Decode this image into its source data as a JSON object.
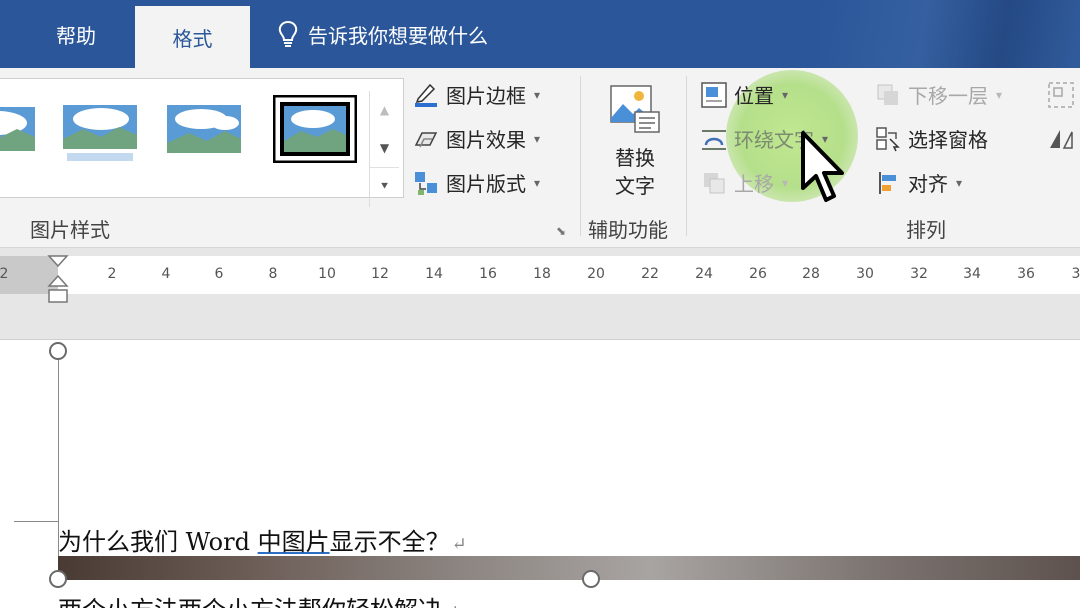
{
  "tabs": {
    "partial_label": "",
    "help": "帮助",
    "format": "格式",
    "tell_me": "告诉我你想要做什么"
  },
  "ribbon": {
    "picture_styles": {
      "label": "图片样式",
      "border": "图片边框",
      "effects": "图片效果",
      "layout": "图片版式"
    },
    "accessibility": {
      "label": "辅助功能",
      "alt_text_line1": "替换",
      "alt_text_line2": "文字"
    },
    "arrange": {
      "label": "排列",
      "position": "位置",
      "wrap_text": "环绕文字",
      "bring_forward": "上移",
      "send_backward": "下移一层",
      "selection_pane": "选择窗格",
      "align": "对齐"
    }
  },
  "ruler": {
    "left_label": "2",
    "ticks": [
      "2",
      "4",
      "6",
      "8",
      "10",
      "12",
      "14",
      "16",
      "18",
      "20",
      "22",
      "24",
      "26",
      "28",
      "30",
      "32",
      "34",
      "36",
      "3"
    ]
  },
  "document": {
    "line1_pre": "为什么我们 Word ",
    "line1_underlined": "中图片",
    "line1_post": "显示不全？",
    "line2": "两个小方法两个小方法帮你轻松解决",
    "paragraph_mark": "↵"
  },
  "colors": {
    "accent": "#2b579a",
    "ribbon_bg": "#f3f3f3",
    "highlight": "#b4dc82"
  }
}
